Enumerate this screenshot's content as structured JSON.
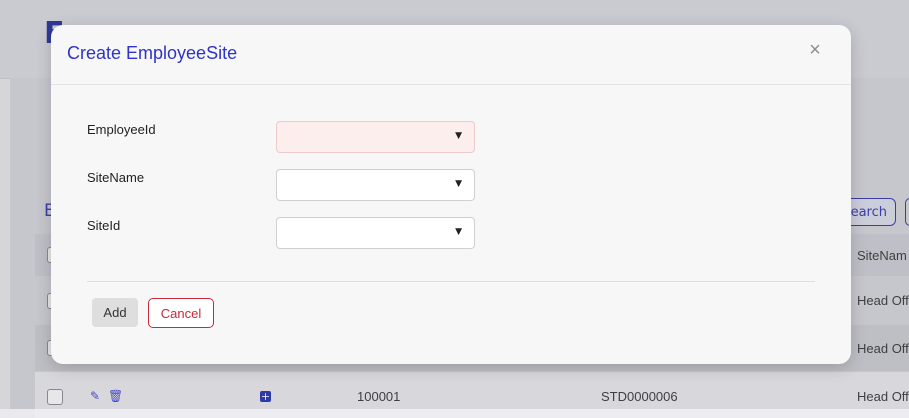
{
  "background": {
    "page_title": "E",
    "section_title": "E",
    "search_button": "earch",
    "table": {
      "header_site_name": "SiteNam",
      "rows": [
        {
          "site_name": "Head Off"
        },
        {
          "site_name": "Head Off"
        },
        {
          "employee_id": "100001",
          "site_id": "STD0000006",
          "site_name": "Head Off"
        }
      ]
    }
  },
  "modal": {
    "title": "Create EmployeeSite",
    "close_glyph": "×",
    "fields": [
      {
        "label": "EmployeeId",
        "value": ""
      },
      {
        "label": "SiteName",
        "value": ""
      },
      {
        "label": "SiteId",
        "value": ""
      }
    ],
    "add_label": "Add",
    "cancel_label": "Cancel"
  },
  "colors": {
    "accent": "#2f33c9",
    "danger": "#c9273a",
    "invalid_bg": "#fdeeee"
  }
}
